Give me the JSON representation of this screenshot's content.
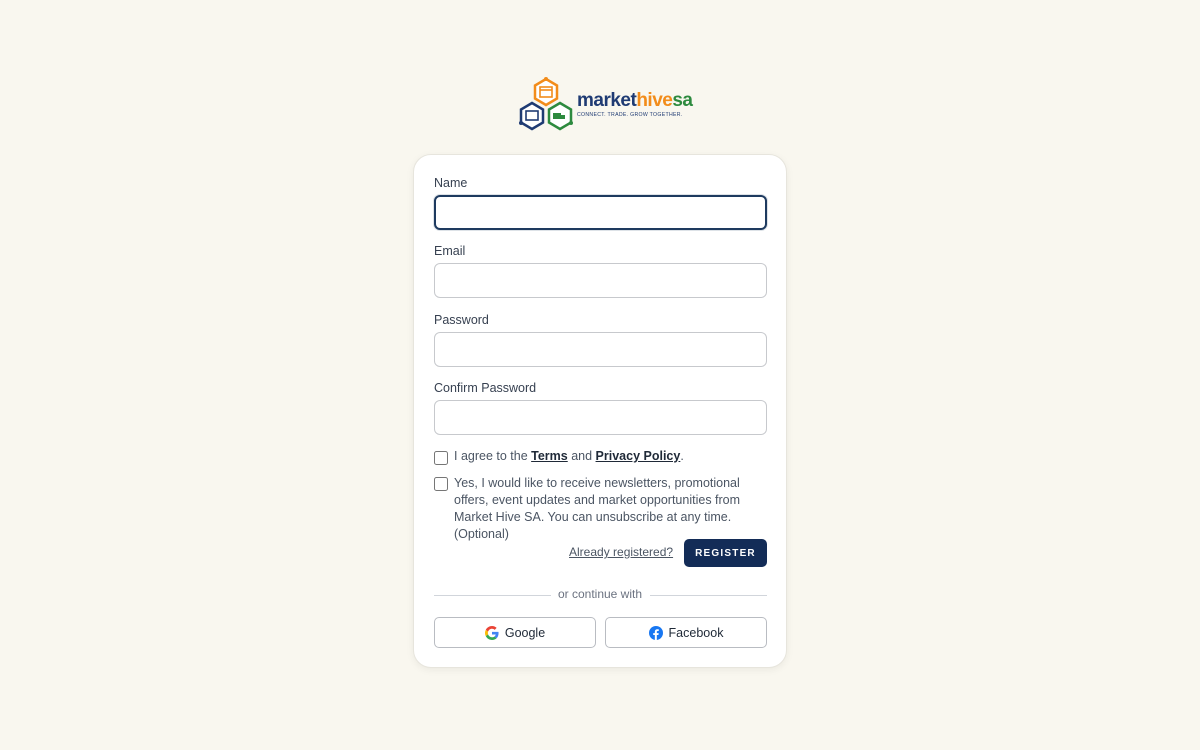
{
  "brand": {
    "name_part1": "market",
    "name_part2": "hive",
    "name_part3": "sa",
    "tagline": "CONNECT. TRADE. GROW TOGETHER."
  },
  "form": {
    "name_label": "Name",
    "name_value": "",
    "email_label": "Email",
    "email_value": "",
    "password_label": "Password",
    "password_value": "",
    "confirm_label": "Confirm Password",
    "confirm_value": "",
    "terms": {
      "prefix": "I agree to the ",
      "terms_link": "Terms",
      "middle": " and ",
      "privacy_link": "Privacy Policy",
      "suffix": ".",
      "checked": false
    },
    "newsletter": {
      "text": "Yes, I would like to receive newsletters, promotional offers, event updates and market opportunities from Market Hive SA. You can unsubscribe at any time. (Optional)",
      "checked": false
    },
    "already_registered": "Already registered?",
    "register_button": "REGISTER"
  },
  "social": {
    "divider": "or continue with",
    "google": "Google",
    "facebook": "Facebook"
  },
  "colors": {
    "background": "#f9f7ef",
    "primary_navy": "#132c57",
    "brand_orange": "#f28c1a",
    "brand_green": "#2d8a3e",
    "facebook_blue": "#1877f2"
  }
}
